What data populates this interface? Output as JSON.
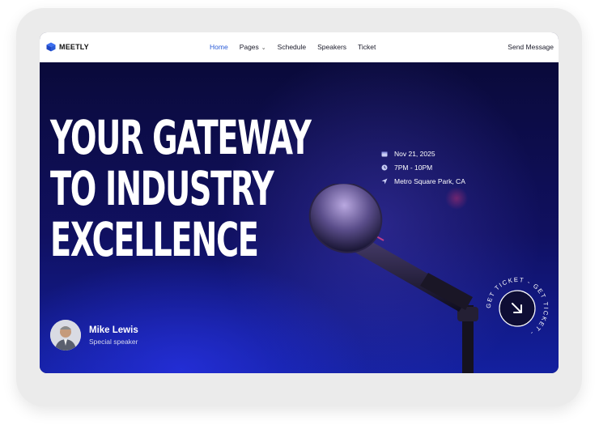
{
  "brand": {
    "name": "MEETLY",
    "icon": "cube-logo-icon"
  },
  "nav": {
    "items": [
      {
        "label": "Home",
        "active": true
      },
      {
        "label": "Pages",
        "dropdown": true
      },
      {
        "label": "Schedule"
      },
      {
        "label": "Speakers"
      },
      {
        "label": "Ticket"
      }
    ],
    "send_message": "Send Message"
  },
  "hero": {
    "headline": [
      "YOUR GATEWAY",
      "TO INDUSTRY",
      "EXCELLENCE"
    ],
    "date": "Nov 21, 2025",
    "time": "7PM - 10PM",
    "location": "Metro Square Park, CA",
    "speaker": {
      "name": "Mike Lewis",
      "role": "Special speaker"
    },
    "ticket_badge": {
      "text": "GET TICKET - GET TICKET -",
      "icon": "arrow-down-right-icon"
    }
  },
  "colors": {
    "accent": "#2a5bd7",
    "hero_bg": "#0b0a3c",
    "hero_glow": "#2832e6",
    "text_light": "#ffffff"
  }
}
